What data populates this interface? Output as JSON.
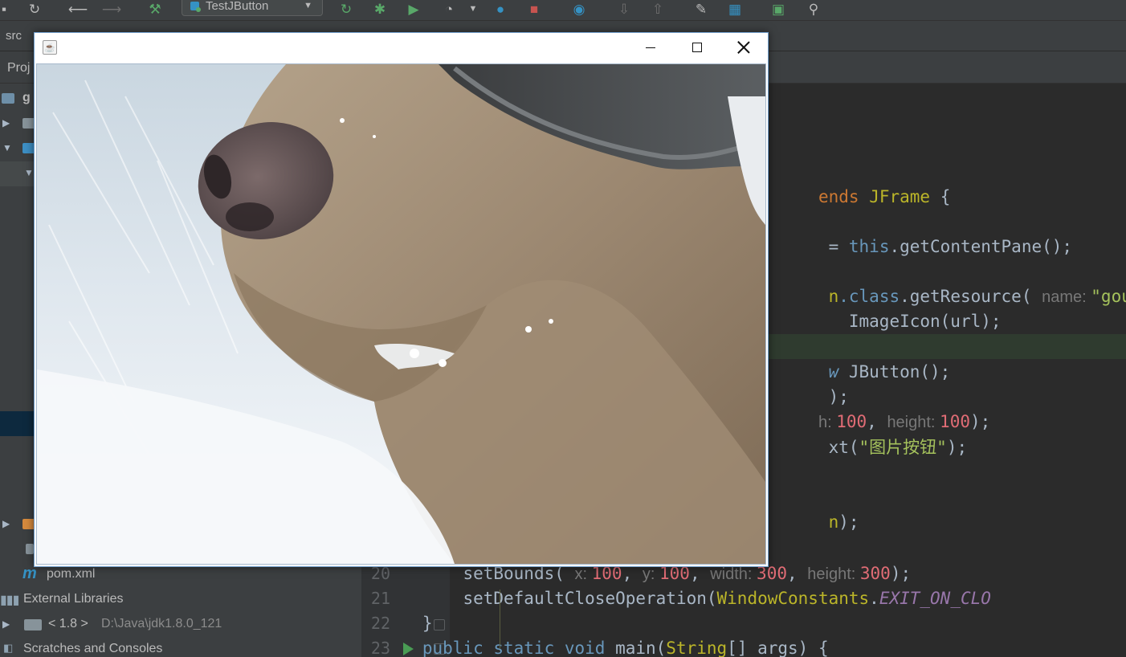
{
  "toolbar": {
    "run_config_label": "TestJButton"
  },
  "breadcrumb": {
    "root": "src"
  },
  "sidebar": {
    "header_label": "Proj",
    "root_item": "g",
    "items": [
      {
        "label": "pom.xml",
        "icon": "maven-file-icon"
      },
      {
        "label": "External Libraries",
        "icon": "libraries-icon"
      },
      {
        "label": "< 1.8 >",
        "detail": "D:\\Java\\jdk1.8.0_121",
        "icon": "jdk-folder-icon"
      },
      {
        "label": "Scratches and Consoles",
        "icon": "scratches-icon"
      }
    ]
  },
  "editor": {
    "line_numbers": [
      "20",
      "21",
      "22",
      "23"
    ],
    "visible_fragments": {
      "l1_kw": "ends",
      "l1_cls": "JFrame",
      "l1_tail": " {",
      "l2_eq": "= ",
      "l2_this": "this",
      "l2_call": ".getContentPane();",
      "l3_pre": "n",
      "l3_class": ".class",
      "l3_call": ".getResource( ",
      "l3_hint": "name: ",
      "l3_str": "\"gougou",
      "l4_code": " ImageIcon(url);",
      "l5_kw": "w",
      "l5_code": " JButton();",
      "l6_code": ");",
      "l7_hint": "h: ",
      "l7_num1": "100",
      "l7_mid": ", ",
      "l7_hint2": "height: ",
      "l7_num2": "100",
      "l7_tail": ");",
      "l8_pre": "xt(",
      "l8_str": "\"图片按钮\"",
      "l8_tail": ");",
      "l9_pre": "n",
      "l9_tail": ");"
    },
    "line20": {
      "method": "setBounds( ",
      "hint_x": "x: ",
      "x": "100",
      "sep1": ", ",
      "hint_y": "y: ",
      "y": "100",
      "sep2": ", ",
      "hint_w": "width: ",
      "w": "300",
      "sep3": ", ",
      "hint_h": "height: ",
      "h": "300",
      "tail": ");"
    },
    "line21": {
      "method": "setDefaultCloseOperation(",
      "cls": "WindowConstants",
      "dot": ".",
      "const": "EXIT_ON_CLO"
    },
    "line22": {
      "code": "}"
    },
    "line23": {
      "mods": "public static void",
      "name": " main(",
      "type": "String",
      "rest": "[] args) {"
    }
  },
  "swing_window": {
    "title": "",
    "app_icon": "java-cup-icon",
    "content": "image-button-dog-in-snow"
  },
  "colors": {
    "ide_bg": "#2b2b2b",
    "panel_bg": "#3c3f41",
    "keyword": "#cc7832",
    "string": "#6a8759",
    "number": "#e06c75",
    "window_border": "#6f9dcb"
  }
}
